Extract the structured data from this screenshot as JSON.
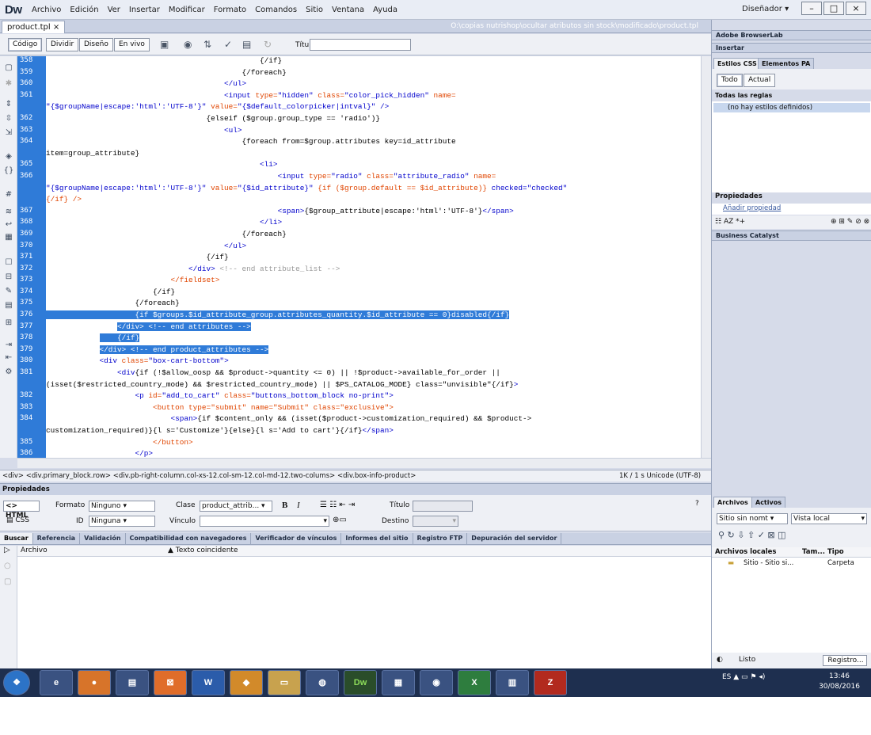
{
  "app": {
    "logo": "Dw",
    "menus": [
      "Archivo",
      "Edición",
      "Ver",
      "Insertar",
      "Modificar",
      "Formato",
      "Comandos",
      "Sitio",
      "Ventana",
      "Ayuda"
    ],
    "workspace": "Diseñador",
    "window_controls": [
      "–",
      "□",
      "×"
    ]
  },
  "doc": {
    "tab": "product.tpl",
    "tab_close": "×",
    "path": "O:\\copias nutrishop\\ocultar atributos sin stock\\modificado\\product.tpl"
  },
  "toolbar": {
    "views": [
      "Código",
      "Dividir",
      "Diseño",
      "En vivo"
    ],
    "title_label": "Título:",
    "title_value": ""
  },
  "code": {
    "lines": [
      [
        {
          "t": "                                                {/if}"
        }
      ],
      [
        {
          "t": "                                            {/foreach}"
        }
      ],
      [
        {
          "t": "                                        "
        },
        {
          "t": "</ul>",
          "c": "tg"
        }
      ],
      [
        {
          "t": "                                        "
        },
        {
          "t": "<input",
          "c": "tg"
        },
        {
          "t": " type=",
          "c": "at"
        },
        {
          "t": "\"hidden\"",
          "c": "st"
        },
        {
          "t": " class=",
          "c": "at"
        },
        {
          "t": "\"color_pick_hidden\"",
          "c": "st"
        },
        {
          "t": " name=",
          "c": "at"
        }
      ],
      [
        {
          "t": "\"{$groupName|escape:'html':'UTF-8'}\"",
          "c": "st"
        },
        {
          "t": " value=",
          "c": "at"
        },
        {
          "t": "\"{$default_colorpicker|intval}\"",
          "c": "st"
        },
        {
          "t": " />",
          "c": "tg"
        }
      ],
      [
        {
          "t": "                                    {elseif ($group.group_type == 'radio')}"
        }
      ],
      [
        {
          "t": "                                        "
        },
        {
          "t": "<ul>",
          "c": "tg"
        }
      ],
      [
        {
          "t": "                                            {foreach from=$group.attributes key=id_attribute"
        }
      ],
      [
        {
          "t": "item=group_attribute}"
        }
      ],
      [
        {
          "t": "                                                "
        },
        {
          "t": "<li>",
          "c": "tg"
        }
      ],
      [
        {
          "t": "                                                    "
        },
        {
          "t": "<input",
          "c": "tg"
        },
        {
          "t": " type=",
          "c": "at"
        },
        {
          "t": "\"radio\"",
          "c": "st"
        },
        {
          "t": " class=",
          "c": "at"
        },
        {
          "t": "\"attribute_radio\"",
          "c": "st"
        },
        {
          "t": " name=",
          "c": "at"
        }
      ],
      [
        {
          "t": "\"{$groupName|escape:'html':'UTF-8'}\"",
          "c": "st"
        },
        {
          "t": " value=",
          "c": "at"
        },
        {
          "t": "\"{$id_attribute}\"",
          "c": "st"
        },
        {
          "t": " {if ($group.default == $id_attribute)} ",
          "c": "at"
        },
        {
          "t": "checked=\"checked\"",
          "c": "st"
        }
      ],
      [
        {
          "t": "{/if} />",
          "c": "at"
        }
      ],
      [
        {
          "t": "                                                    "
        },
        {
          "t": "<span>",
          "c": "tg"
        },
        {
          "t": "{$group_attribute|escape:'html':'UTF-8'}"
        },
        {
          "t": "</span>",
          "c": "tg"
        }
      ],
      [
        {
          "t": "                                                "
        },
        {
          "t": "</li>",
          "c": "tg"
        }
      ],
      [
        {
          "t": "                                            {/foreach}"
        }
      ],
      [
        {
          "t": "                                        "
        },
        {
          "t": "</ul>",
          "c": "tg"
        }
      ],
      [
        {
          "t": "                                    {/if}"
        }
      ],
      [
        {
          "t": "                                "
        },
        {
          "t": "</div>",
          "c": "tg"
        },
        {
          "t": " <!-- end attribute_list -->",
          "c": "cm"
        }
      ],
      [
        {
          "t": "                            "
        },
        {
          "t": "</fieldset>",
          "c": "at"
        }
      ],
      [
        {
          "t": "                        {/if}"
        }
      ],
      [
        {
          "t": "                    {/foreach}"
        }
      ],
      [
        {
          "t": "                    {if $groups.$id_attribute_group.attributes_quantity.$id_attribute == 0}disabled{/if}",
          "hl": true
        }
      ],
      [
        {
          "t": "                "
        },
        {
          "t": "</div> <!-- end attributes -->",
          "hl": true
        }
      ],
      [
        {
          "t": "            ",
          "hl": false
        },
        {
          "t": "    {/if}",
          "hl": true
        }
      ],
      [
        {
          "t": "            "
        },
        {
          "t": "</div> <!-- end product_attributes -->",
          "hl": true
        }
      ],
      [
        {
          "t": "            "
        },
        {
          "t": "<div",
          "c": "tg"
        },
        {
          "t": " class=",
          "c": "at"
        },
        {
          "t": "\"box-cart-bottom\"",
          "c": "st"
        },
        {
          "t": ">",
          "c": "tg"
        }
      ],
      [
        {
          "t": "                "
        },
        {
          "t": "<div",
          "c": "tg"
        },
        {
          "t": "{if (!$allow_oosp && $product->quantity <= 0) || !$product->available_for_order ||"
        }
      ],
      [
        {
          "t": "(isset($restricted_country_mode) && $restricted_country_mode) || $PS_CATALOG_MODE} class=\"unvisible\"{/if}"
        },
        {
          "t": ">",
          "c": "tg"
        }
      ],
      [
        {
          "t": "                    "
        },
        {
          "t": "<p",
          "c": "tg"
        },
        {
          "t": " id=",
          "c": "at"
        },
        {
          "t": "\"add_to_cart\"",
          "c": "st"
        },
        {
          "t": " class=",
          "c": "at"
        },
        {
          "t": "\"buttons_bottom_block no-print\"",
          "c": "st"
        },
        {
          "t": ">",
          "c": "tg"
        }
      ],
      [
        {
          "t": "                        "
        },
        {
          "t": "<button",
          "c": "at"
        },
        {
          "t": " type=",
          "c": "at"
        },
        {
          "t": "\"submit\"",
          "c": "at"
        },
        {
          "t": " name=",
          "c": "at"
        },
        {
          "t": "\"Submit\"",
          "c": "at"
        },
        {
          "t": " class=",
          "c": "at"
        },
        {
          "t": "\"exclusive\"",
          "c": "at"
        },
        {
          "t": ">",
          "c": "at"
        }
      ],
      [
        {
          "t": "                            "
        },
        {
          "t": "<span>",
          "c": "tg"
        },
        {
          "t": "{if $content_only && (isset($product->customization_required) && $product->"
        }
      ],
      [
        {
          "t": "customization_required)}{l s='Customize'}{else}{l s='Add to cart'}{/if}"
        },
        {
          "t": "</span>",
          "c": "tg"
        }
      ],
      [
        {
          "t": "                        "
        },
        {
          "t": "</button>",
          "c": "at"
        }
      ],
      [
        {
          "t": "                    "
        },
        {
          "t": "</p>",
          "c": "tg"
        }
      ]
    ],
    "line_numbers": [
      "358",
      "359",
      "360",
      "361",
      "",
      "362",
      "363",
      "364",
      "",
      "365",
      "366",
      "",
      "",
      "367",
      "368",
      "369",
      "370",
      "371",
      "372",
      "373",
      "374",
      "375",
      "376",
      "377",
      "378",
      "379",
      "380",
      "381",
      "",
      "382",
      "383",
      "384",
      "",
      "385",
      "386"
    ]
  },
  "status": {
    "breadcrumb": "<div> <div.primary_block.row> <div.pb-right-column.col-xs-12.col-sm-12.col-md-12.two-colums> <div.box-info-product>",
    "info": "1K / 1 s  Unicode (UTF-8)"
  },
  "props": {
    "header": "Propiedades",
    "html_btn": "<> HTML",
    "css_btn": "CSS",
    "formato_lbl": "Formato",
    "formato_val": "Ninguno",
    "id_lbl": "ID",
    "id_val": "Ninguna",
    "clase_lbl": "Clase",
    "clase_val": "product_attrib...",
    "vinculo_lbl": "Vínculo",
    "vinculo_val": "",
    "titulo_lbl": "Título",
    "destino_lbl": "Destino",
    "bold": "B",
    "italic": "I"
  },
  "results": {
    "tabs": [
      "Buscar",
      "Referencia",
      "Validación",
      "Compatibilidad con navegadores",
      "Verificador de vínculos",
      "Informes del sitio",
      "Registro FTP",
      "Depuración del servidor"
    ],
    "col_archivo": "Archivo",
    "col_texto": "Texto coincidente"
  },
  "rpanel": {
    "browserlab": "Adobe BrowserLab",
    "insertar": "Insertar",
    "css_tab": "Estilos CSS",
    "pa_tab": "Elementos PA",
    "todo": "Todo",
    "actual": "Actual",
    "todas": "Todas las reglas",
    "no_styles": "(no hay estilos definidos)",
    "propiedades": "Propiedades",
    "anadir": "Añadir propiedad",
    "bc": "Business Catalyst",
    "archivos_tab": "Archivos",
    "activos_tab": "Activos",
    "site_sel": "Sitio sin nomt",
    "view_sel": "Vista local",
    "archivos_locales": "Archivos locales",
    "tam": "Tam...",
    "tipo": "Tipo",
    "site_row": "Sitio - Sitio si...",
    "carpeta": "Carpeta",
    "listo": "Listo",
    "registro": "Registro..."
  },
  "taskbar": {
    "apps": [
      "start",
      "ie",
      "firefox",
      "explorer",
      "xampp",
      "word",
      "pdf",
      "folder",
      "vb",
      "dw",
      "cmd",
      "chrome",
      "excel",
      "files",
      "filezilla"
    ],
    "lang": "ES",
    "time": "13:46",
    "date": "30/08/2016"
  }
}
